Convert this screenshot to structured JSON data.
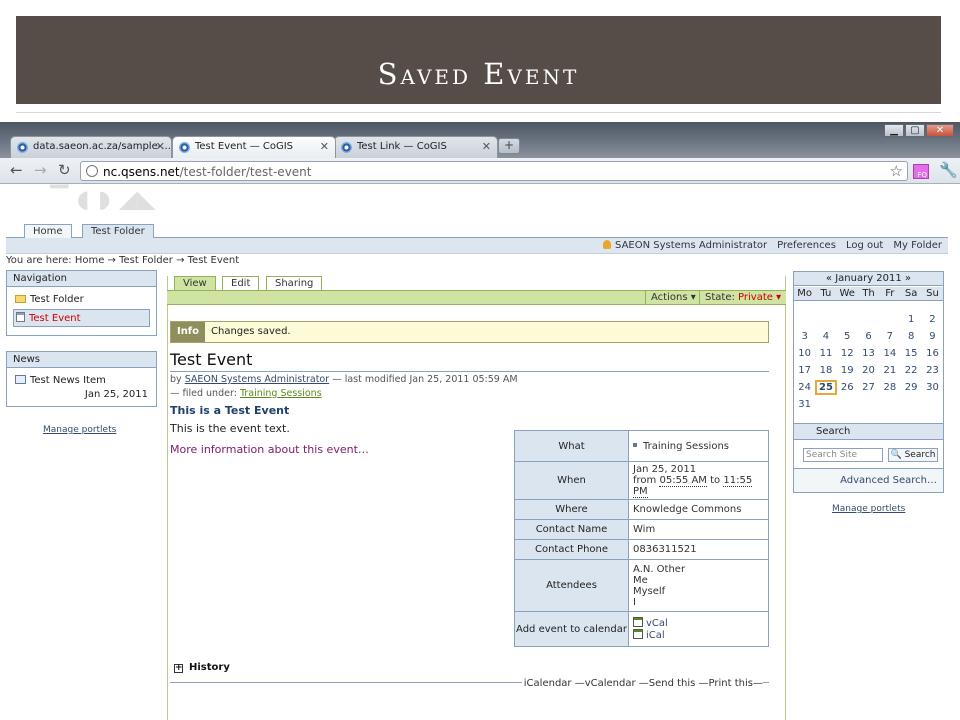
{
  "slide": {
    "title": "Saved Event"
  },
  "browser": {
    "tabs": [
      {
        "title": "data.saeon.ac.za/sample-..."
      },
      {
        "title": "Test Event — CoGIS"
      },
      {
        "title": "Test Link — CoGIS"
      }
    ],
    "url_host": "nc.qsens.net",
    "url_path": "/test-folder/test-event",
    "extension_badge": "FQ"
  },
  "site": {
    "sections": [
      "Home",
      "Test Folder"
    ],
    "personal_bar": {
      "user": "SAEON Systems Administrator",
      "links": [
        "Preferences",
        "Log out",
        "My Folder"
      ]
    },
    "breadcrumbs": "You are here: Home → Test Folder → Test Event"
  },
  "navigation": {
    "title": "Navigation",
    "items": [
      "Test Folder",
      "Test Event"
    ]
  },
  "news": {
    "title": "News",
    "item_title": "Test News Item",
    "item_date": "Jan 25, 2011"
  },
  "manage_portlets": "Manage portlets",
  "content": {
    "tabs": [
      "View",
      "Edit",
      "Sharing"
    ],
    "actions_label": "Actions ▾",
    "state_label": "State:",
    "state_value": "Private ▾",
    "info_label": "Info",
    "info_message": "Changes saved.",
    "title": "Test Event",
    "by": "by",
    "author": "SAEON Systems Administrator",
    "modified": "— last modified Jan 25, 2011 05:59 AM",
    "filed_under": "— filed under:",
    "category": "Training Sessions",
    "description": "This is a Test Event",
    "text": "This is the event text.",
    "more_info": "More information about this event…",
    "history": "History",
    "doc_actions": "iCalendar —vCalendar —Send this —Print this—"
  },
  "event": {
    "what_label": "What",
    "what_value": "Training Sessions",
    "when_label": "When",
    "when_date": "Jan 25, 2011",
    "when_from": "from",
    "when_start": "05:55 AM",
    "when_to": "to",
    "when_end": "11:55 PM",
    "where_label": "Where",
    "where_value": "Knowledge Commons",
    "contact_name_label": "Contact Name",
    "contact_name_value": "Wim",
    "contact_phone_label": "Contact Phone",
    "contact_phone_value": "0836311521",
    "attendees_label": "Attendees",
    "attendees": [
      "A.N. Other",
      "Me",
      "Myself",
      "I"
    ],
    "calendar_label": "Add event to calendar",
    "vcal": "vCal",
    "ical": "iCal"
  },
  "calendar": {
    "header": "« January 2011 »",
    "dow": [
      "Mo",
      "Tu",
      "We",
      "Th",
      "Fr",
      "Sa",
      "Su"
    ],
    "weeks": [
      [
        "",
        "",
        "",
        "",
        "",
        "1",
        "2"
      ],
      [
        "3",
        "4",
        "5",
        "6",
        "7",
        "8",
        "9"
      ],
      [
        "10",
        "11",
        "12",
        "13",
        "14",
        "15",
        "16"
      ],
      [
        "17",
        "18",
        "19",
        "20",
        "21",
        "22",
        "23"
      ],
      [
        "24",
        "25",
        "26",
        "27",
        "28",
        "29",
        "30"
      ],
      [
        "31",
        "",
        "",
        "",
        "",
        "",
        ""
      ]
    ],
    "today": "25"
  },
  "search": {
    "title": "Search",
    "placeholder": "Search Site",
    "button": "Search",
    "advanced": "Advanced Search…"
  }
}
